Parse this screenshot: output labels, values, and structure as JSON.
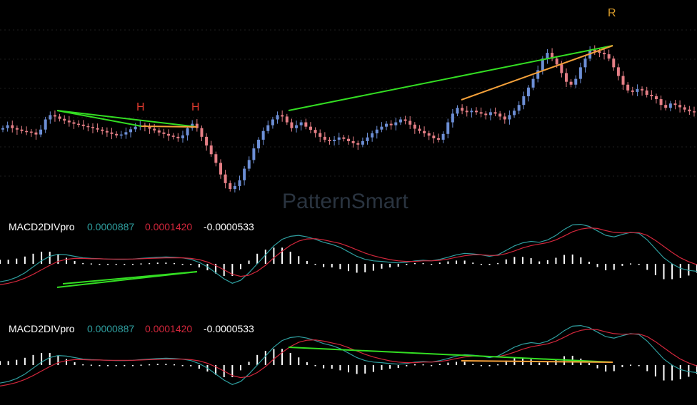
{
  "watermark": "PatternSmart",
  "markers": {
    "h1": "H",
    "h2": "H",
    "r": "R"
  },
  "colors": {
    "background": "#000000",
    "grid": "#1e1e1e",
    "bull_candle": "#6d8fd6",
    "bear_candle": "#e57f86",
    "macd_line": "#2f9fa0",
    "signal_line": "#d3273c",
    "histogram": "#ffffff",
    "divergence_green": "#33dd22",
    "divergence_orange": "#f5a13a",
    "marker_h": "#e03a2e",
    "marker_r": "#d79b2a"
  },
  "indicators": [
    {
      "name": "MACD2DIVpro",
      "v1": "0.0000887",
      "v2": "0.0001420",
      "v3": "-0.0000533"
    },
    {
      "name": "MACD2DIVpro",
      "v1": "0.0000887",
      "v2": "0.0001420",
      "v3": "-0.0000533"
    }
  ],
  "chart_data": {
    "type": "candlestick",
    "price_closes": [
      100,
      101,
      100,
      99.5,
      99,
      98.8,
      98.5,
      97.8,
      99.5,
      103,
      104.5,
      104,
      103.2,
      102.6,
      102,
      101.5,
      101.2,
      100.7,
      100.4,
      100,
      99.5,
      99,
      98.5,
      98,
      97.5,
      97.8,
      98.6,
      99.6,
      100.5,
      101,
      100.4,
      99.8,
      99.2,
      98.5,
      98,
      97.4,
      97,
      96.5,
      97.5,
      100,
      101.5,
      100,
      97,
      94,
      91,
      88,
      84,
      81,
      79,
      80,
      82,
      86,
      89,
      93,
      96,
      99,
      101,
      103,
      104.5,
      104,
      102,
      100,
      101,
      102,
      100.5,
      99.4,
      98.3,
      97,
      96,
      95.5,
      96,
      96.8,
      96.3,
      95.5,
      94.8,
      94.3,
      95.5,
      96.8,
      98.2,
      99.5,
      100.5,
      101.5,
      101,
      102,
      103,
      102.5,
      101.2,
      99.8,
      99,
      98.2,
      97.4,
      96.5,
      96,
      98,
      102,
      105,
      107,
      106,
      105.5,
      106,
      105.5,
      105,
      104.5,
      105.5,
      105,
      104,
      103,
      104.5,
      106,
      108,
      111,
      114,
      117,
      120,
      124,
      126,
      124,
      122,
      119,
      116,
      115,
      117,
      121,
      124,
      127,
      126.5,
      126,
      125.5,
      124,
      121,
      118,
      115,
      113,
      112.5,
      113.5,
      113,
      111.5,
      111,
      110,
      108,
      107,
      108.5,
      108,
      107.2,
      106.4,
      105.8,
      105.5
    ],
    "macd_line": [
      -0.6,
      -0.55,
      -0.45,
      -0.3,
      -0.1,
      0.1,
      0.25,
      0.32,
      0.3,
      0.25,
      0.2,
      0.18,
      0.17,
      0.16,
      0.15,
      0.15,
      0.16,
      0.18,
      0.2,
      0.22,
      0.23,
      0.22,
      0.2,
      0.15,
      0.05,
      -0.1,
      -0.3,
      -0.5,
      -0.65,
      -0.55,
      -0.3,
      0,
      0.3,
      0.6,
      0.82,
      0.92,
      0.95,
      0.9,
      0.82,
      0.72,
      0.65,
      0.55,
      0.4,
      0.25,
      0.15,
      0.1,
      0.08,
      0.05,
      0.03,
      0.05,
      0.1,
      0.12,
      0.1,
      0.15,
      0.22,
      0.3,
      0.35,
      0.33,
      0.3,
      0.25,
      0.3,
      0.45,
      0.6,
      0.7,
      0.75,
      0.72,
      0.8,
      0.95,
      1.15,
      1.3,
      1.32,
      1.25,
      1.1,
      0.95,
      0.9,
      0.98,
      1.05,
      1.02,
      0.8,
      0.5,
      0.2,
      0,
      -0.15,
      -0.22,
      -0.25
    ],
    "signal_line": [
      -0.7,
      -0.65,
      -0.58,
      -0.48,
      -0.35,
      -0.2,
      -0.05,
      0.08,
      0.15,
      0.18,
      0.18,
      0.17,
      0.17,
      0.16,
      0.16,
      0.16,
      0.16,
      0.17,
      0.18,
      0.19,
      0.2,
      0.2,
      0.2,
      0.18,
      0.14,
      0.06,
      -0.06,
      -0.2,
      -0.35,
      -0.42,
      -0.38,
      -0.25,
      -0.05,
      0.2,
      0.42,
      0.62,
      0.76,
      0.83,
      0.84,
      0.8,
      0.74,
      0.68,
      0.58,
      0.47,
      0.36,
      0.27,
      0.2,
      0.14,
      0.1,
      0.08,
      0.08,
      0.1,
      0.1,
      0.12,
      0.16,
      0.22,
      0.27,
      0.3,
      0.3,
      0.28,
      0.28,
      0.34,
      0.43,
      0.53,
      0.61,
      0.66,
      0.71,
      0.8,
      0.93,
      1.07,
      1.16,
      1.2,
      1.18,
      1.11,
      1.05,
      1.03,
      1.04,
      1.04,
      0.95,
      0.78,
      0.58,
      0.38,
      0.2,
      0.07,
      -0.03
    ],
    "histogram": [
      0.1,
      0.1,
      0.13,
      0.18,
      0.25,
      0.3,
      0.3,
      0.24,
      0.15,
      0.07,
      0.02,
      0.01,
      0,
      0,
      -0.01,
      -0.01,
      0,
      0.01,
      0.02,
      0.03,
      0.03,
      0.02,
      0,
      -0.03,
      -0.09,
      -0.16,
      -0.24,
      -0.3,
      -0.3,
      -0.13,
      0.08,
      0.25,
      0.35,
      0.4,
      0.4,
      0.3,
      0.19,
      0.07,
      -0.02,
      -0.08,
      -0.09,
      -0.13,
      -0.18,
      -0.22,
      -0.21,
      -0.17,
      -0.12,
      -0.09,
      -0.07,
      -0.03,
      0.02,
      0.02,
      0,
      0.03,
      0.06,
      0.08,
      0.08,
      0.03,
      0,
      -0.03,
      0.02,
      0.11,
      0.17,
      0.17,
      0.14,
      0.06,
      0.09,
      0.15,
      0.22,
      0.23,
      0.16,
      0.05,
      -0.08,
      -0.16,
      -0.15,
      -0.05,
      0.01,
      -0.02,
      -0.15,
      -0.28,
      -0.38,
      -0.38,
      -0.35,
      -0.29,
      -0.22
    ]
  }
}
